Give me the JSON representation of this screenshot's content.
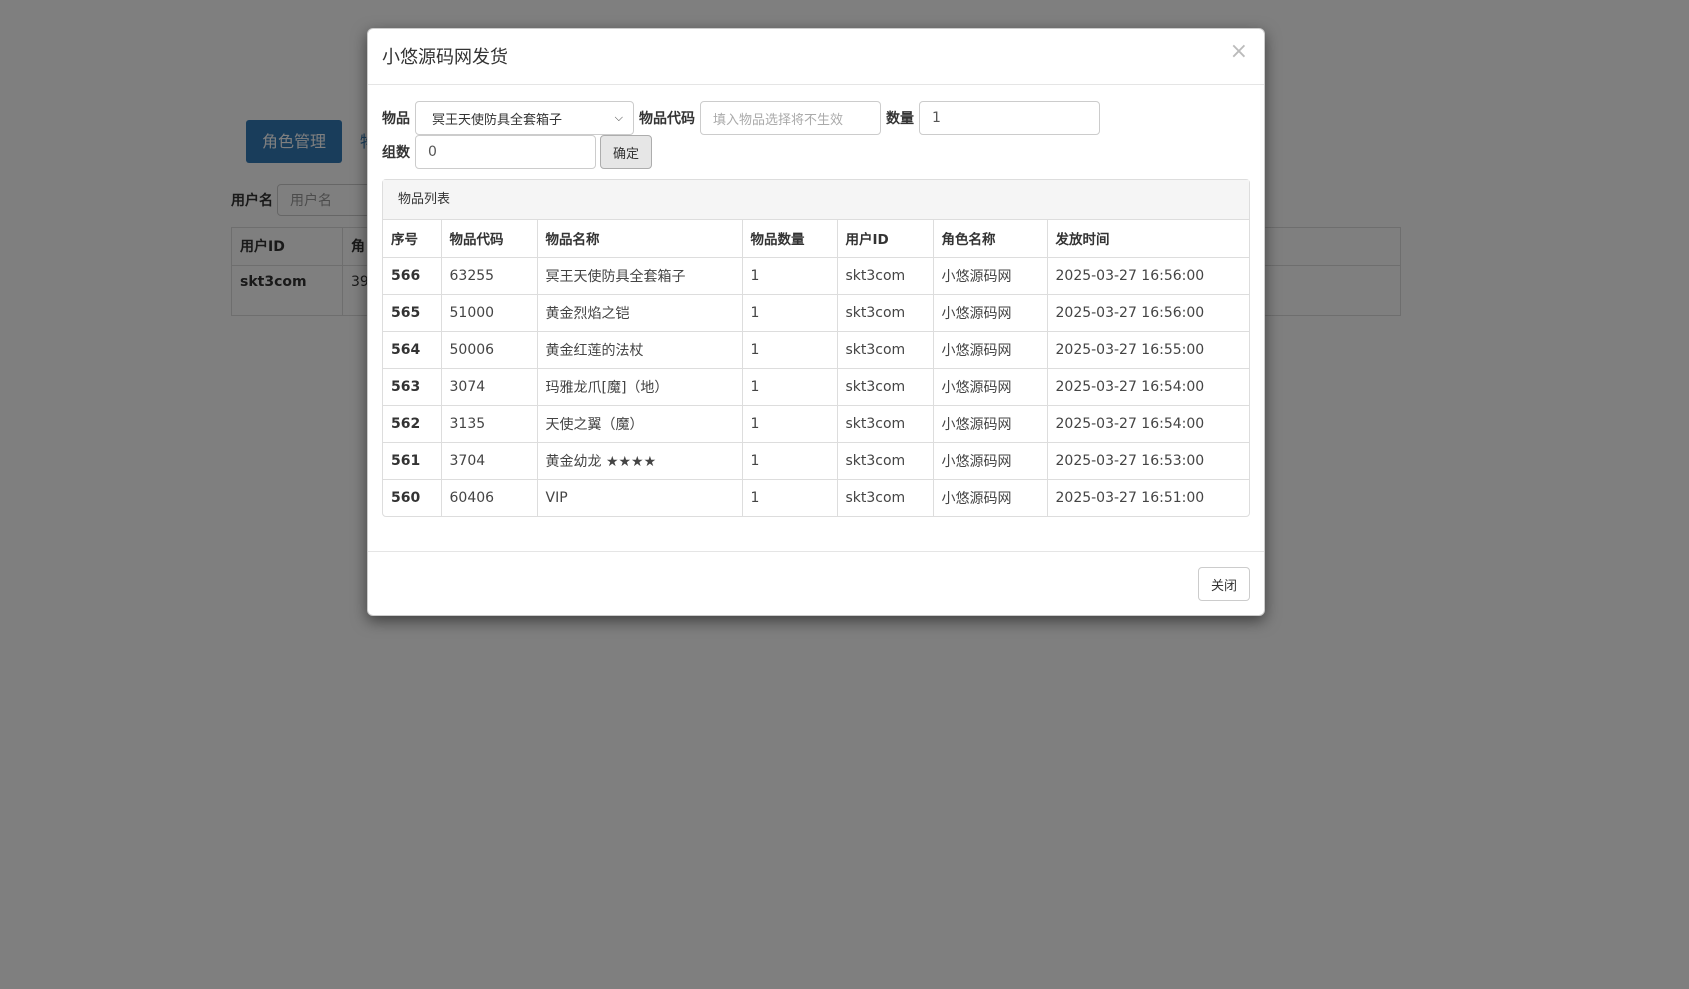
{
  "background": {
    "nav": {
      "active_tab": "角色管理",
      "next_tab_partial": "物"
    },
    "search": {
      "label": "用户名",
      "placeholder": "用户名"
    },
    "table": {
      "headers": [
        "用户ID",
        "角"
      ],
      "row": [
        "skt3com",
        "39"
      ]
    }
  },
  "modal": {
    "title": "小悠源码网发货",
    "close_symbol": "×",
    "form": {
      "item_label": "物品",
      "item_selected": "冥王天使防具全套箱子",
      "code_label": "物品代码",
      "code_placeholder": "填入物品选择将不生效",
      "qty_label": "数量",
      "qty_value": "1",
      "group_label": "组数",
      "group_value": "0",
      "confirm_label": "确定"
    },
    "panel": {
      "heading": "物品列表",
      "columns": [
        "序号",
        "物品代码",
        "物品名称",
        "物品数量",
        "用户ID",
        "角色名称",
        "发放时间"
      ],
      "rows": [
        [
          "566",
          "63255",
          "冥王天使防具全套箱子",
          "1",
          "skt3com",
          "小悠源码网",
          "2025-03-27 16:56:00"
        ],
        [
          "565",
          "51000",
          "黄金烈焰之铠",
          "1",
          "skt3com",
          "小悠源码网",
          "2025-03-27 16:56:00"
        ],
        [
          "564",
          "50006",
          "黄金红莲的法杖",
          "1",
          "skt3com",
          "小悠源码网",
          "2025-03-27 16:55:00"
        ],
        [
          "563",
          "3074",
          "玛雅龙爪[魔]（地）",
          "1",
          "skt3com",
          "小悠源码网",
          "2025-03-27 16:54:00"
        ],
        [
          "562",
          "3135",
          "天使之翼（魔）",
          "1",
          "skt3com",
          "小悠源码网",
          "2025-03-27 16:54:00"
        ],
        [
          "561",
          "3704",
          "黄金幼龙 ★★★★",
          "1",
          "skt3com",
          "小悠源码网",
          "2025-03-27 16:53:00"
        ],
        [
          "560",
          "60406",
          "VIP",
          "1",
          "skt3com",
          "小悠源码网",
          "2025-03-27 16:51:00"
        ]
      ]
    },
    "footer": {
      "close_label": "关闭"
    }
  }
}
